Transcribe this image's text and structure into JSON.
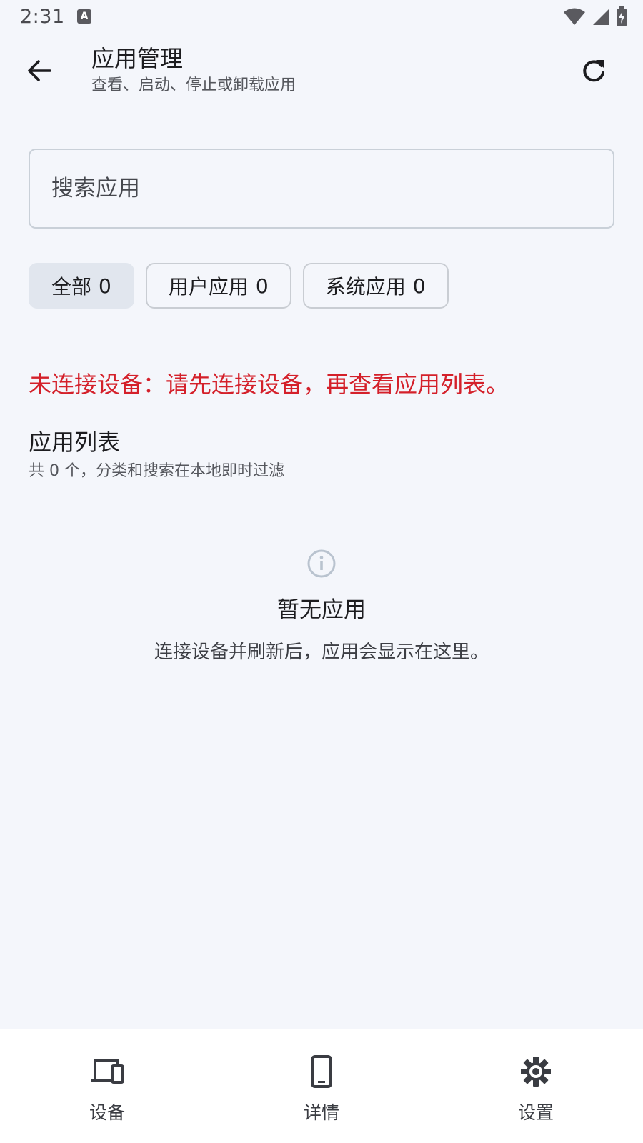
{
  "status_bar": {
    "time": "2:31",
    "app_icon_letter": "A"
  },
  "header": {
    "title": "应用管理",
    "subtitle": "查看、启动、停止或卸载应用"
  },
  "search": {
    "placeholder": "搜索应用",
    "value": ""
  },
  "filters": [
    {
      "label": "全部",
      "count": "0",
      "selected": true
    },
    {
      "label": "用户应用",
      "count": "0",
      "selected": false
    },
    {
      "label": "系统应用",
      "count": "0",
      "selected": false
    }
  ],
  "error_message": "未连接设备：请先连接设备，再查看应用列表。",
  "list": {
    "title": "应用列表",
    "summary": "共 0 个，分类和搜索在本地即时过滤"
  },
  "empty_state": {
    "icon": "info-icon",
    "title": "暂无应用",
    "description": "连接设备并刷新后，应用会显示在这里。"
  },
  "bottom_nav": [
    {
      "label": "设备",
      "icon": "devices-icon"
    },
    {
      "label": "详情",
      "icon": "phone-icon"
    },
    {
      "label": "设置",
      "icon": "gear-icon"
    }
  ],
  "colors": {
    "background": "#f4f6fb",
    "error": "#d4202a",
    "chip_selected": "#e1e6ee"
  }
}
